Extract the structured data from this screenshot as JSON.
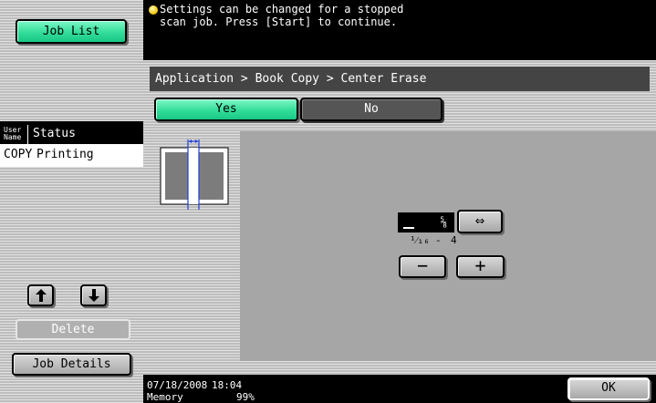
{
  "left_panel": {
    "job_list_label": "Job List",
    "status_table": {
      "headers": [
        "User Name",
        "Status"
      ],
      "rows": [
        [
          "COPY",
          "Printing"
        ]
      ]
    },
    "up_icon": "up-arrow-icon",
    "down_icon": "down-arrow-icon",
    "delete_label": "Delete",
    "job_details_label": "Job Details"
  },
  "message": {
    "icon": "info-bulb-icon",
    "line1": "Settings can be changed for a stopped",
    "line2": "scan job. Press [Start] to continue."
  },
  "breadcrumb": "Application > Book Copy > Center Erase",
  "toggle": {
    "yes_label": "Yes",
    "no_label": "No",
    "selected": "Yes"
  },
  "erase_width": {
    "value": "⅝",
    "unit_hint_icon": "width-arrow-icon",
    "direction_icon": "left-right-arrow-icon",
    "direction_symbol": "⇔",
    "range_min": "¹⁄₁₆",
    "range_sep": "-",
    "range_max": "4",
    "minus_symbol": "−",
    "plus_symbol": "+"
  },
  "footer": {
    "date": "07/18/2008",
    "time": "18:04",
    "memory_label": "Memory",
    "memory_value": "99%",
    "ok_label": "OK"
  },
  "colors": {
    "accent_green": "#33dd9a",
    "stripe_gray": "#bdbdbd",
    "breadcrumb_bg": "#444444",
    "preview_panel": "#a6a6a6"
  }
}
